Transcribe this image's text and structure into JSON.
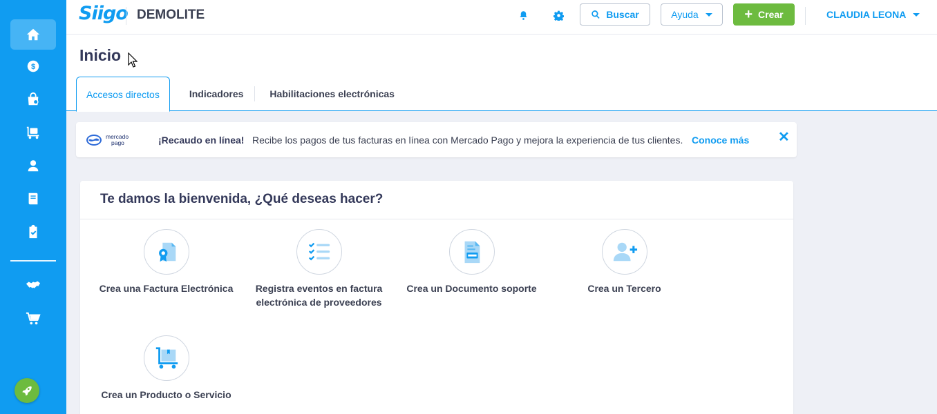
{
  "app": {
    "logo_text": "Siigo",
    "company": "DEMOLITE"
  },
  "header": {
    "search_label": "Buscar",
    "help_label": "Ayuda",
    "create_label": "Crear",
    "user_name": "CLAUDIA LEONA"
  },
  "sidebar": {
    "items": [
      {
        "name": "home",
        "icon": "home-icon",
        "active": true
      },
      {
        "name": "sales",
        "icon": "dollar-icon"
      },
      {
        "name": "purchases",
        "icon": "shopping-bag-icon"
      },
      {
        "name": "inventory",
        "icon": "cart-dolly-icon"
      },
      {
        "name": "contacts",
        "icon": "person-icon"
      },
      {
        "name": "accounting",
        "icon": "book-icon"
      },
      {
        "name": "tasks",
        "icon": "clipboard-check-icon"
      },
      {
        "name": "partners",
        "icon": "handshake-icon"
      },
      {
        "name": "store",
        "icon": "shopping-cart-icon"
      }
    ],
    "rocket_icon": "rocket-icon"
  },
  "page": {
    "title": "Inicio",
    "tabs": [
      {
        "label": "Accesos directos",
        "active": true
      },
      {
        "label": "Indicadores"
      },
      {
        "label": "Habilitaciones electrónicas"
      }
    ]
  },
  "banner": {
    "logo_text_1": "mercado",
    "logo_text_2": "pago",
    "title": "¡Recaudo en línea!",
    "text": "Recibe los pagos de tus facturas en línea con Mercado Pago y mejora la experiencia de tus clientes.",
    "link": "Conoce más",
    "close": "✕"
  },
  "welcome": {
    "title": "Te damos la bienvenida, ¿Qué deseas hacer?",
    "shortcuts": [
      {
        "label": "Crea una Factura Electrónica",
        "icon": "invoice-ribbon-icon"
      },
      {
        "label": "Registra eventos en factura electrónica de proveedores",
        "icon": "checklist-icon"
      },
      {
        "label": "Crea un Documento soporte",
        "icon": "support-document-icon"
      },
      {
        "label": "Crea un Tercero",
        "icon": "add-person-icon"
      },
      {
        "label": "Crea un Producto o Servicio",
        "icon": "product-cart-icon"
      }
    ]
  },
  "colors": {
    "primary": "#109cf1",
    "sidebar_active": "#46b4f5",
    "green": "#6dbb3f",
    "background": "#eef0f6",
    "text": "#34395a"
  }
}
